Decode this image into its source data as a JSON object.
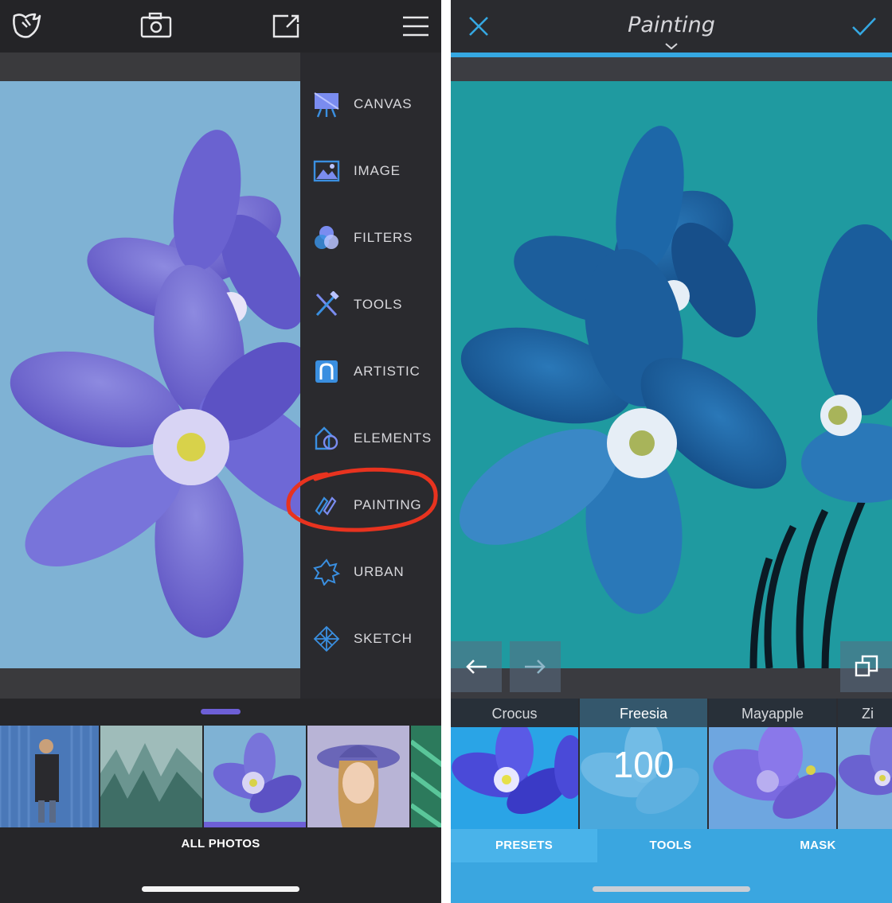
{
  "colors": {
    "accent_purple": "#6d5fd6",
    "accent_blue": "#35a8e2",
    "highlight_circle": "#e8331f",
    "menu_icon_blue": "#3a8fe0"
  },
  "left": {
    "toolbar": {
      "icons": [
        "logo-icon",
        "camera-icon",
        "share-icon",
        "hamburger-menu-icon"
      ]
    },
    "menu": {
      "items": [
        {
          "label": "CANVAS",
          "icon": "canvas-easel-icon"
        },
        {
          "label": "IMAGE",
          "icon": "image-icon"
        },
        {
          "label": "FILTERS",
          "icon": "filters-icon"
        },
        {
          "label": "TOOLS",
          "icon": "tools-icon"
        },
        {
          "label": "ARTISTIC",
          "icon": "artistic-icon"
        },
        {
          "label": "ELEMENTS",
          "icon": "elements-icon"
        },
        {
          "label": "PAINTING",
          "icon": "painting-brush-icon"
        },
        {
          "label": "URBAN",
          "icon": "urban-icon"
        },
        {
          "label": "SKETCH",
          "icon": "sketch-icon"
        }
      ]
    },
    "photos": {
      "label": "ALL PHOTOS",
      "selected_index": 2
    }
  },
  "right": {
    "header": {
      "title": "Painting",
      "close_icon": "close-icon",
      "confirm_icon": "checkmark-icon"
    },
    "presets": [
      {
        "label": "Crocus"
      },
      {
        "label": "Freesia",
        "value": "100"
      },
      {
        "label": "Mayapple"
      },
      {
        "label": "Zi"
      }
    ],
    "selected_preset": 1,
    "tabs": [
      {
        "label": "PRESETS"
      },
      {
        "label": "TOOLS"
      },
      {
        "label": "MASK"
      }
    ],
    "active_tab": 0
  }
}
